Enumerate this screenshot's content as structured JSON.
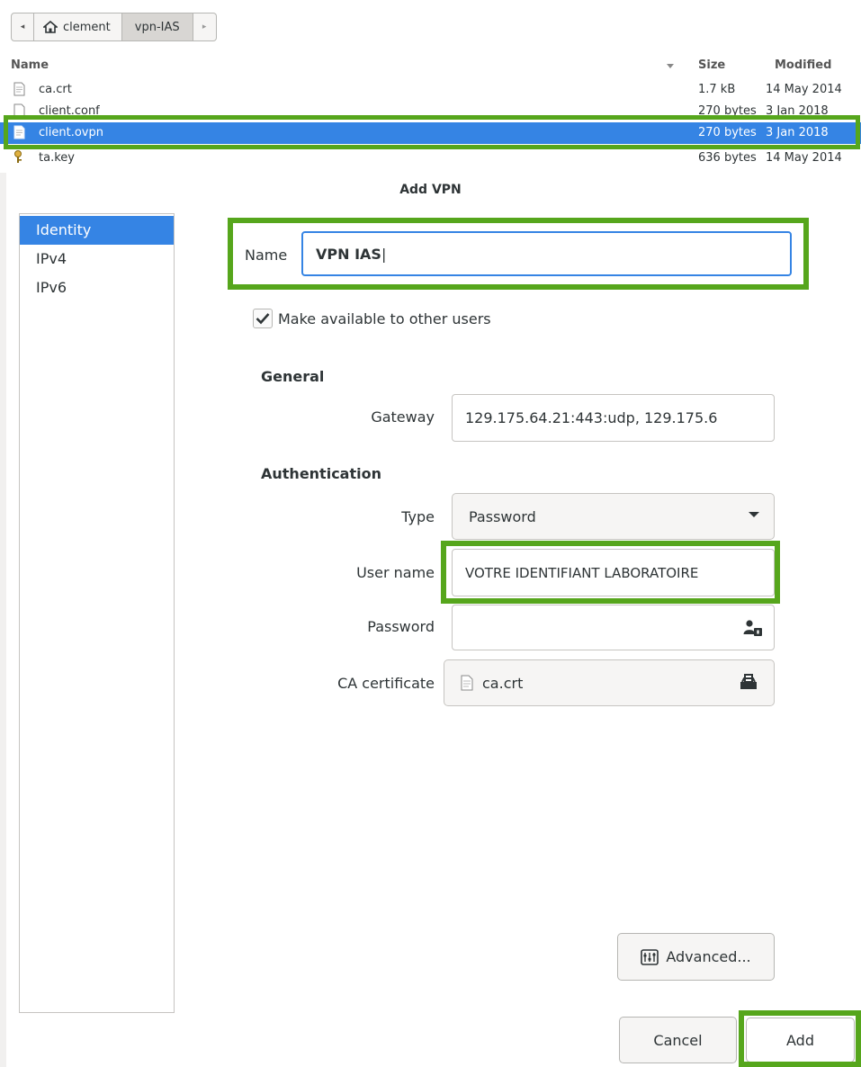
{
  "file_chooser": {
    "pathbar": {
      "back_label": "◂",
      "home_label": "clement",
      "current_label": "vpn-IAS",
      "forward_label": "▸"
    },
    "columns": {
      "name": "Name",
      "size": "Size",
      "modified": "Modified"
    },
    "files": [
      {
        "name": "ca.crt",
        "size": "1.7 kB",
        "modified": "14 May 2014",
        "icon": "text-file-icon"
      },
      {
        "name": "client.conf",
        "size": "270 bytes",
        "modified": "3 Jan 2018",
        "icon": "text-file-icon"
      },
      {
        "name": "client.ovpn",
        "size": "270 bytes",
        "modified": "3 Jan 2018",
        "icon": "text-file-icon",
        "selected": true
      },
      {
        "name": "ta.key",
        "size": "636 bytes",
        "modified": "14 May 2014",
        "icon": "key-file-icon"
      }
    ]
  },
  "dialog": {
    "title": "Add VPN",
    "sidebar": [
      {
        "label": "Identity",
        "selected": true
      },
      {
        "label": "IPv4",
        "selected": false
      },
      {
        "label": "IPv6",
        "selected": false
      }
    ],
    "name": {
      "label": "Name",
      "value": "VPN IAS"
    },
    "available_to_others": {
      "label": "Make available to other users",
      "checked": true
    },
    "general": {
      "heading": "General",
      "gateway_label": "Gateway",
      "gateway_value": "129.175.64.21:443:udp, 129.175.6"
    },
    "authentication": {
      "heading": "Authentication",
      "type_label": "Type",
      "type_value": "Password",
      "username_label": "User name",
      "username_value": "VOTRE IDENTIFIANT LABORATOIRE",
      "password_label": "Password",
      "password_value": "",
      "ca_label": "CA certificate",
      "ca_value": "ca.crt"
    },
    "buttons": {
      "advanced": "Advanced...",
      "cancel": "Cancel",
      "add": "Add"
    }
  },
  "colors": {
    "accent": "#3584e4",
    "annotation_green": "#56a61c"
  }
}
